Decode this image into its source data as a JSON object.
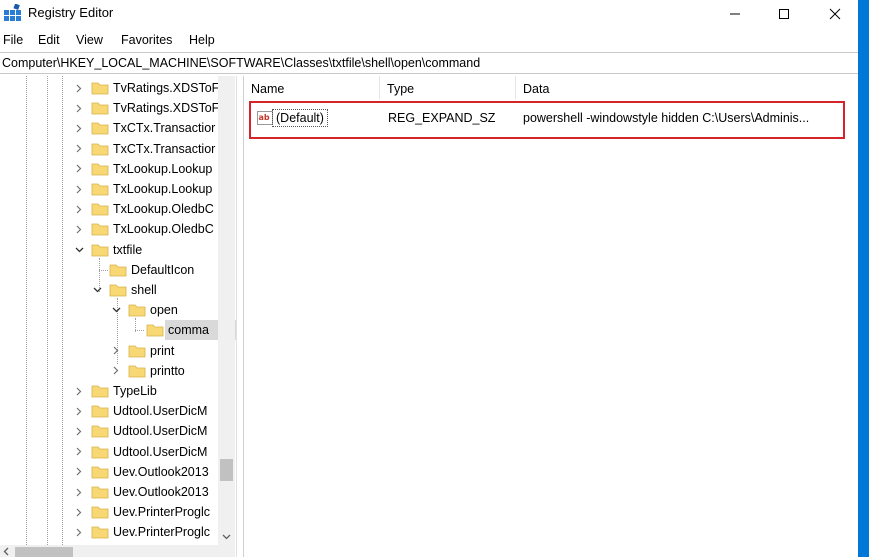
{
  "window": {
    "title": "Registry Editor",
    "minimize_icon": "minimize-icon",
    "maximize_icon": "maximize-icon",
    "close_icon": "close-icon"
  },
  "menu": [
    "File",
    "Edit",
    "View",
    "Favorites",
    "Help"
  ],
  "address": "Computer\\HKEY_LOCAL_MACHINE\\SOFTWARE\\Classes\\txtfile\\shell\\open\\command",
  "tree": {
    "items": [
      {
        "label": "TvRatings.XDSToF",
        "state": "collapsed"
      },
      {
        "label": "TvRatings.XDSToF",
        "state": "collapsed"
      },
      {
        "label": "TxCTx.Transactior",
        "state": "collapsed"
      },
      {
        "label": "TxCTx.Transactior",
        "state": "collapsed"
      },
      {
        "label": "TxLookup.Lookup",
        "state": "collapsed"
      },
      {
        "label": "TxLookup.Lookup",
        "state": "collapsed"
      },
      {
        "label": "TxLookup.OledbC",
        "state": "collapsed"
      },
      {
        "label": "TxLookup.OledbC",
        "state": "collapsed"
      },
      {
        "label": "txtfile",
        "state": "expanded"
      },
      {
        "label": "DefaultIcon",
        "state": "leaf"
      },
      {
        "label": "shell",
        "state": "expanded"
      },
      {
        "label": "open",
        "state": "expanded"
      },
      {
        "label": "comma",
        "state": "selected"
      },
      {
        "label": "print",
        "state": "collapsed"
      },
      {
        "label": "printto",
        "state": "collapsed"
      },
      {
        "label": "TypeLib",
        "state": "collapsed"
      },
      {
        "label": "Udtool.UserDicM",
        "state": "collapsed"
      },
      {
        "label": "Udtool.UserDicM",
        "state": "collapsed"
      },
      {
        "label": "Udtool.UserDicM",
        "state": "collapsed"
      },
      {
        "label": "Uev.Outlook2013",
        "state": "collapsed"
      },
      {
        "label": "Uev.Outlook2013",
        "state": "collapsed"
      },
      {
        "label": "Uev.PrinterProglc",
        "state": "collapsed"
      },
      {
        "label": "Uev.PrinterProglc",
        "state": "collapsed"
      }
    ]
  },
  "list": {
    "columns": [
      "Name",
      "Type",
      "Data"
    ],
    "rows": [
      {
        "name": "(Default)",
        "type": "REG_EXPAND_SZ",
        "data": "powershell -windowstyle hidden C:\\Users\\Adminis...",
        "icon": "string-value-icon"
      }
    ]
  },
  "colors": {
    "highlight_border": "#d4242c",
    "folder": "#f8d775",
    "selection": "#d9d9d9",
    "accent": "#0078d7"
  }
}
